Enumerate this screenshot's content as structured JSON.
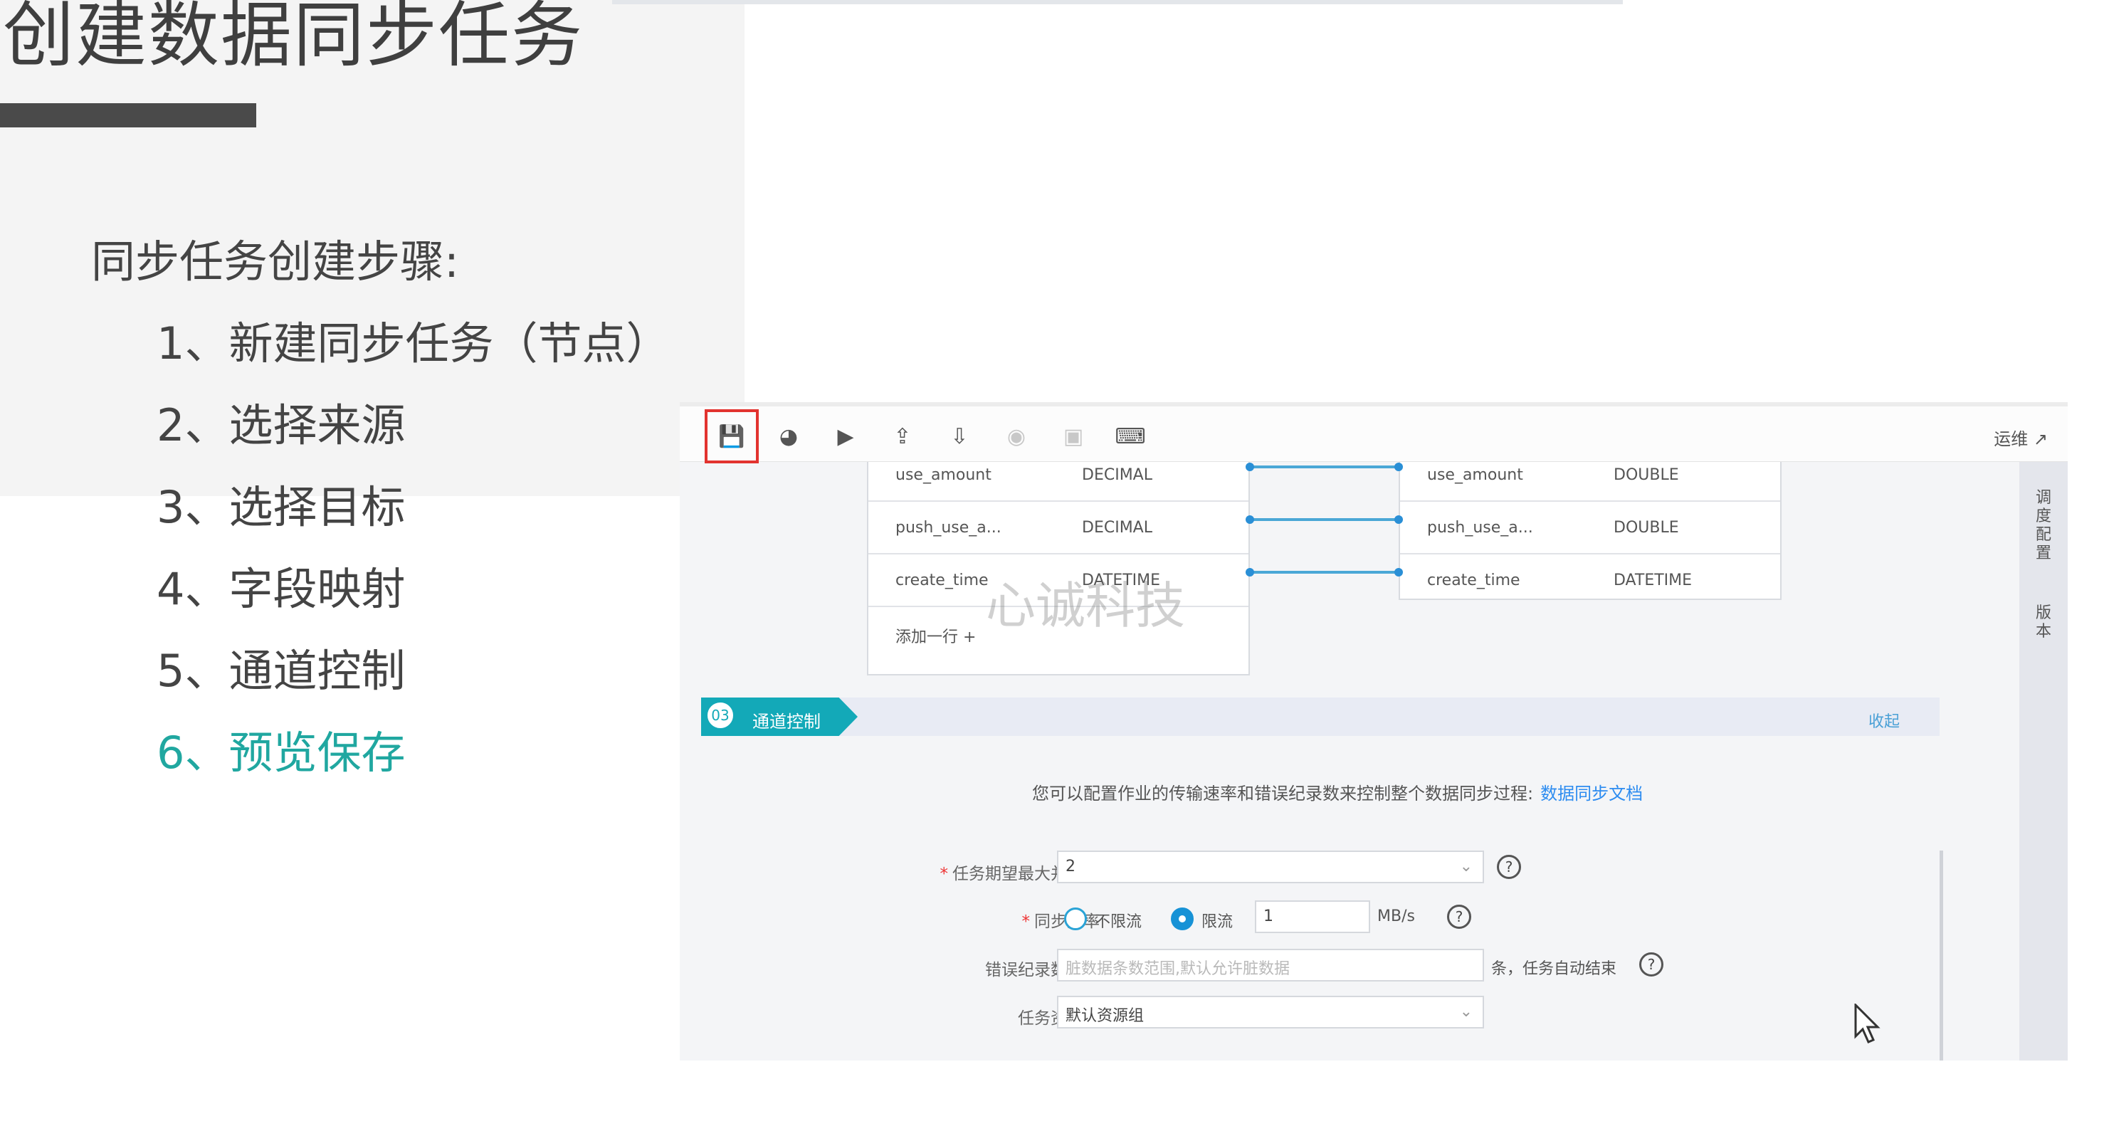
{
  "slide": {
    "title": "创建数据同步任务",
    "steps_heading": "同步任务创建步骤:",
    "steps": [
      {
        "label": "1、新建同步任务（节点）"
      },
      {
        "label": "2、选择来源"
      },
      {
        "label": "3、选择目标"
      },
      {
        "label": "4、字段映射"
      },
      {
        "label": "5、通道控制"
      },
      {
        "label": "6、预览保存"
      }
    ],
    "active_step_color": "#20a7a0"
  },
  "toolbar": {
    "icons": [
      "save-icon",
      "run-icon",
      "run-step-icon",
      "submit-icon",
      "export-icon",
      "stop-icon",
      "lock-icon",
      "code-icon"
    ],
    "ops_label": "运维 ↗"
  },
  "right_rail": {
    "schedule_label": "调度配置",
    "version_label": "版本"
  },
  "mapping": {
    "source_rows": [
      {
        "name": "use_amount",
        "type": "DECIMAL"
      },
      {
        "name": "push_use_a...",
        "type": "DECIMAL"
      },
      {
        "name": "create_time",
        "type": "DATETIME"
      }
    ],
    "add_row_label": "添加一行 +",
    "target_rows": [
      {
        "name": "use_amount",
        "type": "DOUBLE"
      },
      {
        "name": "push_use_a...",
        "type": "DOUBLE"
      },
      {
        "name": "create_time",
        "type": "DATETIME"
      }
    ]
  },
  "watermark": "心诚科技",
  "channel": {
    "step_number": "03",
    "title": "通道控制",
    "collapse_label": "收起",
    "intro": "您可以配置作业的传输速率和错误纪录数来控制整个数据同步过程:",
    "doc_link": "数据同步文档",
    "fields": {
      "concurrency_label": "任务期望最大并发数",
      "concurrency_value": "2",
      "rate_label": "同步速率",
      "rate_unlimited": "不限流",
      "rate_limited": "限流",
      "rate_value": "1",
      "rate_unit": "MB/s",
      "error_label": "错误纪录数超过",
      "error_placeholder": "脏数据条数范围,默认允许脏数据",
      "error_suffix": "条，任务自动结束",
      "resource_label": "任务资源组",
      "resource_value": "默认资源组"
    }
  }
}
